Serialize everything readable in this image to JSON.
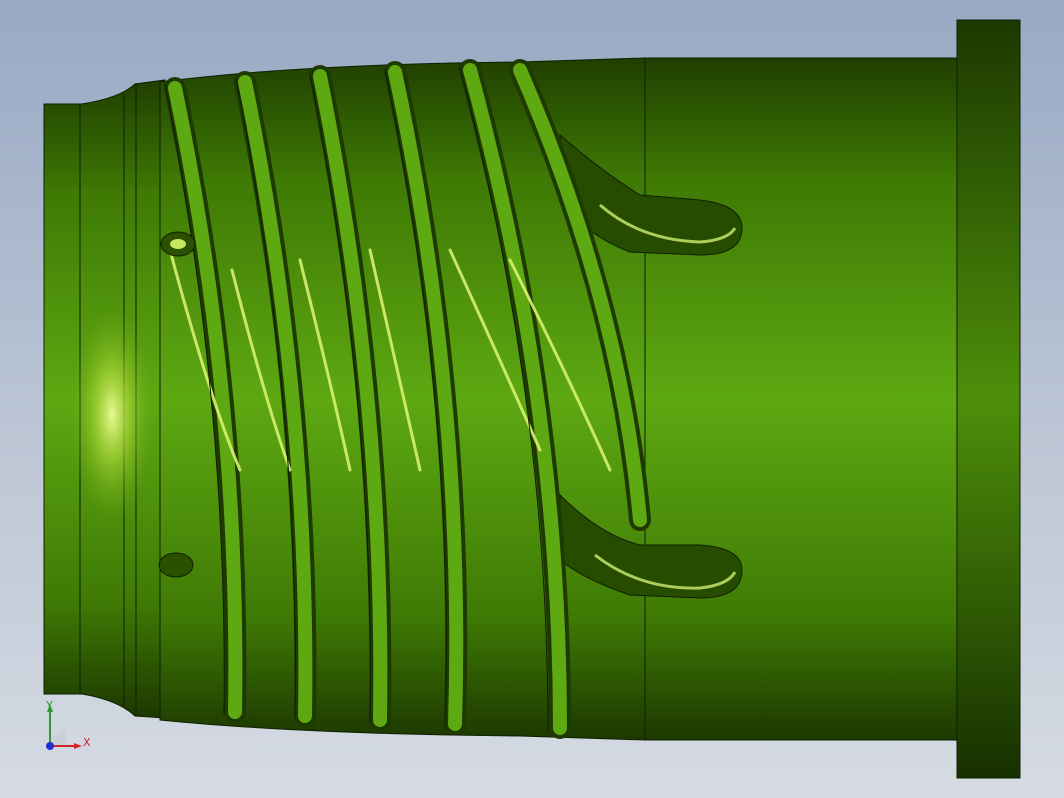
{
  "viewport": {
    "background_top": "#97a9c4",
    "background_bottom": "#d6dbe3"
  },
  "model": {
    "name": "helical-grooved-sleeve",
    "base_color": "#4a8a0a",
    "highlight_color": "#d8f070",
    "shadow_color": "#1f3a00",
    "edge_color": "#0f1f00"
  },
  "triad": {
    "x_label": "X",
    "y_label": "Y",
    "x_color": "#d0262a",
    "y_color": "#2a9a2a",
    "z_color": "#2030d0"
  }
}
